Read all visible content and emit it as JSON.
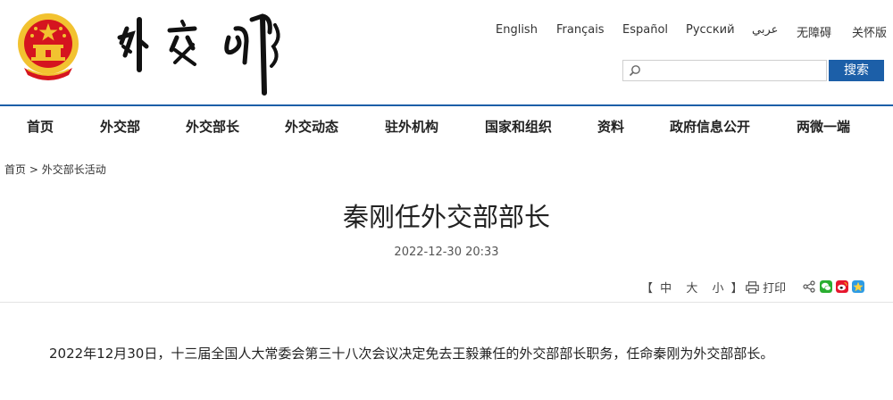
{
  "header": {
    "languages": [
      "English",
      "Français",
      "Español",
      "Русский",
      "عربي",
      "无障碍",
      "关怀版"
    ],
    "search": {
      "placeholder": "",
      "button_label": "搜索"
    }
  },
  "nav": {
    "items": [
      "首页",
      "外交部",
      "外交部长",
      "外交动态",
      "驻外机构",
      "国家和组织",
      "资料",
      "政府信息公开",
      "两微一端"
    ]
  },
  "breadcrumb": {
    "home": "首页",
    "separator": ">",
    "current": "外交部长活动"
  },
  "article": {
    "title": "秦刚任外交部部长",
    "datetime": "2022-12-30 20:33",
    "font_size_label": {
      "open": "【",
      "large": "中",
      "medium": "大",
      "small": "小",
      "close": "】"
    },
    "print_label": "打印",
    "body": "2022年12月30日，十三届全国人大常委会第三十八次会议决定免去王毅兼任的外交部部长职务，任命秦刚为外交部部长。"
  },
  "share": {
    "icons": [
      "share-icon",
      "wechat-icon",
      "weibo-icon",
      "qzone-icon"
    ]
  },
  "colors": {
    "brand_blue": "#1c5fa8",
    "emblem_red": "#d5141f",
    "emblem_gold": "#f2c230"
  }
}
